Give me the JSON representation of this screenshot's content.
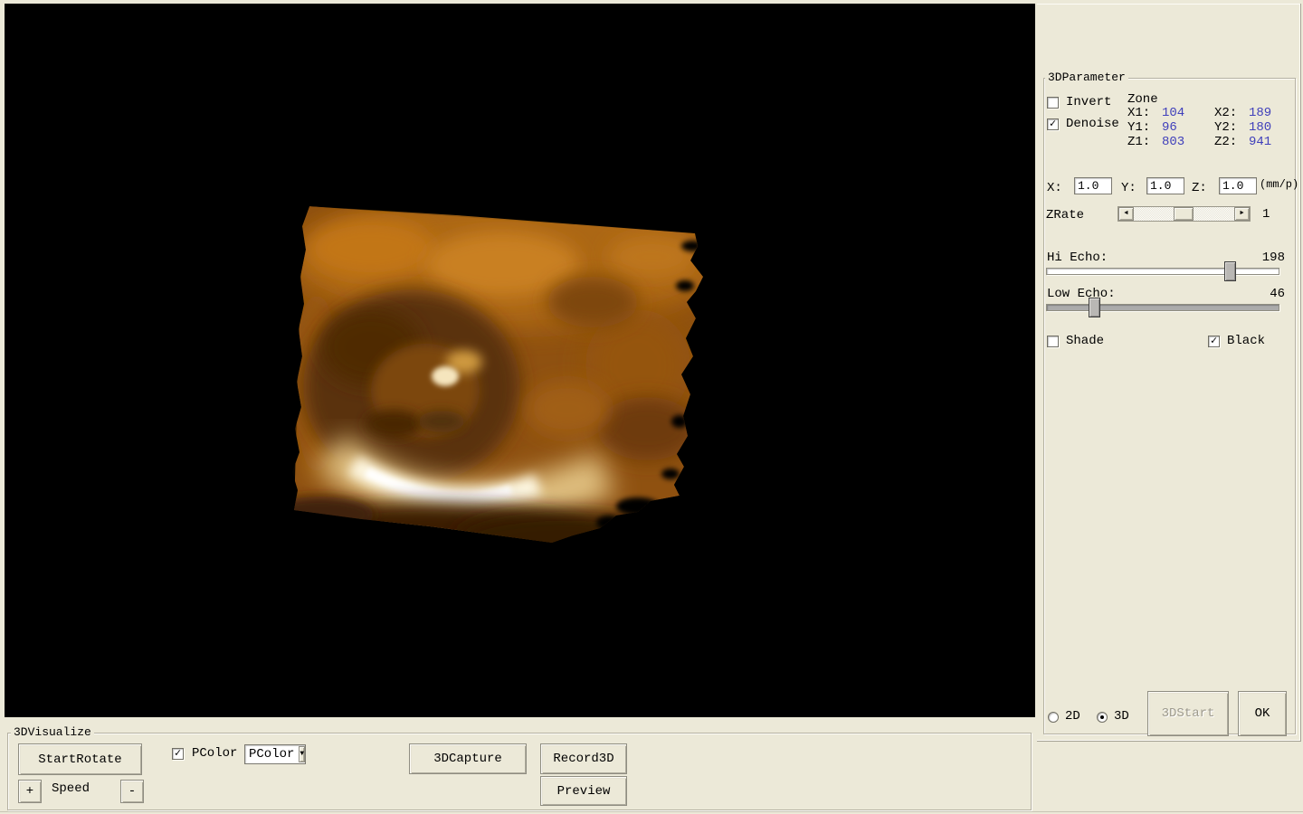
{
  "colors": {
    "window_bg": "#ece9d8",
    "viewport_bg": "#000000",
    "zone_value_color": "#4040bb",
    "render_base_amber": "#8f5110",
    "render_highlight": "#fdf6e0",
    "render_dark_shadow": "#4a2806"
  },
  "right_panel": {
    "group_title": "3DParameter",
    "invert": {
      "label": "Invert",
      "checked": false
    },
    "denoise": {
      "label": "Denoise",
      "checked": true
    },
    "zone": {
      "title": "Zone",
      "rows": [
        {
          "l1": "X1:",
          "v1": "104",
          "l2": "X2:",
          "v2": "189"
        },
        {
          "l1": "Y1:",
          "v1": "96",
          "l2": "Y2:",
          "v2": "180"
        },
        {
          "l1": "Z1:",
          "v1": "803",
          "l2": "Z2:",
          "v2": "941"
        }
      ]
    },
    "scale": {
      "x_label": "X:",
      "x_value": "1.0",
      "y_label": "Y:",
      "y_value": "1.0",
      "z_label": "Z:",
      "z_value": "1.0",
      "unit": "(mm/p)"
    },
    "zrate": {
      "label": "ZRate",
      "value": "1"
    },
    "hi_echo": {
      "label": "Hi Echo:",
      "value": "198"
    },
    "low_echo": {
      "label": "Low Echo:",
      "value": "46"
    },
    "shade": {
      "label": "Shade",
      "checked": false
    },
    "black": {
      "label": "Black",
      "checked": true
    },
    "mode_2d": {
      "label": "2D",
      "selected": false
    },
    "mode_3d": {
      "label": "3D",
      "selected": true
    },
    "start_button": "3DStart",
    "ok_button": "OK"
  },
  "bottom_panel": {
    "group_title": "3DVisualize",
    "start_rotate_button": "StartRotate",
    "pcolor_checkbox": {
      "label": "PColor",
      "checked": true
    },
    "pcolor_combo": {
      "value": "PColor"
    },
    "capture_button": "3DCapture",
    "record_button": "Record3D",
    "preview_button": "Preview",
    "speed_plus_button": "+",
    "speed_label": "Speed",
    "speed_minus_button": "-"
  },
  "icons": {
    "check": "✓",
    "arrow_left": "◄",
    "arrow_right": "►",
    "dropdown": "▼"
  }
}
